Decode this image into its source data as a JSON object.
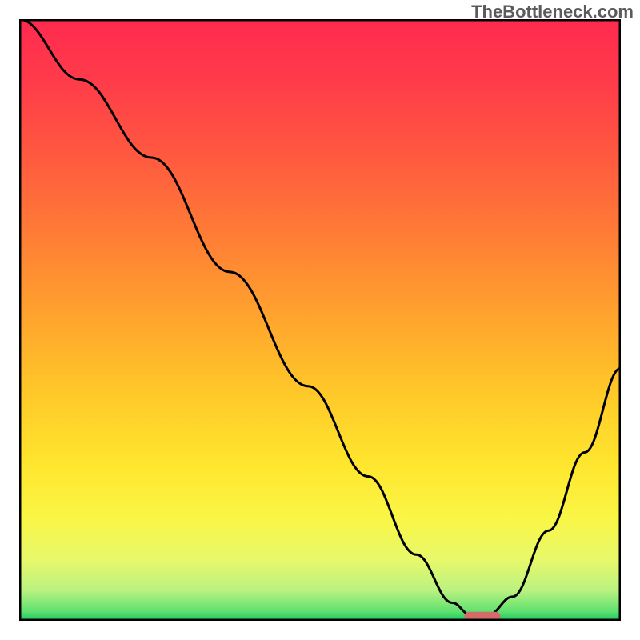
{
  "watermark": "TheBottleneck.com",
  "chart_data": {
    "type": "line",
    "title": "",
    "xlabel": "",
    "ylabel": "",
    "xlim": [
      0,
      100
    ],
    "ylim": [
      0,
      100
    ],
    "series": [
      {
        "name": "bottleneck-curve",
        "x": [
          0,
          10,
          22,
          35,
          48,
          58,
          66,
          72,
          75,
          78,
          82,
          88,
          94,
          100
        ],
        "values": [
          100,
          90,
          77,
          58,
          39,
          24,
          11,
          3,
          1,
          1,
          4,
          15,
          28,
          42
        ]
      }
    ],
    "grid": false,
    "legend": false,
    "marker": {
      "name": "optimal-range-marker",
      "x_start": 74,
      "x_end": 80,
      "y": 0.7,
      "color": "#d56a6a"
    },
    "gradient_stops": [
      {
        "pos": 0.0,
        "color": "#ff2a4f"
      },
      {
        "pos": 0.1,
        "color": "#ff3b4a"
      },
      {
        "pos": 0.22,
        "color": "#ff5740"
      },
      {
        "pos": 0.35,
        "color": "#ff7a36"
      },
      {
        "pos": 0.5,
        "color": "#ffa52d"
      },
      {
        "pos": 0.62,
        "color": "#ffc829"
      },
      {
        "pos": 0.74,
        "color": "#ffe62e"
      },
      {
        "pos": 0.83,
        "color": "#faf646"
      },
      {
        "pos": 0.9,
        "color": "#e7f86b"
      },
      {
        "pos": 0.95,
        "color": "#b9f281"
      },
      {
        "pos": 0.985,
        "color": "#5de06f"
      },
      {
        "pos": 1.0,
        "color": "#18c95c"
      }
    ]
  }
}
